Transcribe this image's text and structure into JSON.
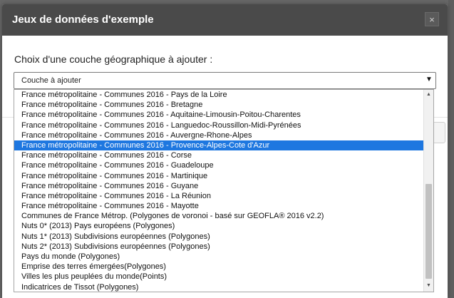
{
  "dialog": {
    "title": "Jeux de données d'exemple",
    "close_glyph": "×"
  },
  "form": {
    "label": "Choix d'une couche géographique à ajouter :",
    "select_value": "Couche à ajouter",
    "select_arrow": "▼"
  },
  "dropdown": {
    "scroll_up_glyph": "▲",
    "scroll_down_glyph": "▼",
    "selected_index": 5,
    "options": [
      "France métropolitaine - Communes 2016 - Pays de la Loire",
      "France métropolitaine - Communes 2016 - Bretagne",
      "France métropolitaine - Communes 2016 - Aquitaine-Limousin-Poitou-Charentes",
      "France métropolitaine - Communes 2016 - Languedoc-Roussillon-Midi-Pyrénées",
      "France métropolitaine - Communes 2016 - Auvergne-Rhone-Alpes",
      "France métropolitaine - Communes 2016 - Provence-Alpes-Cote d'Azur",
      "France métropolitaine - Communes 2016 - Corse",
      "France métropolitaine - Communes 2016 - Guadeloupe",
      "France métropolitaine - Communes 2016 - Martinique",
      "France métropolitaine - Communes 2016 - Guyane",
      "France métropolitaine - Communes 2016 - La Réunion",
      "France métropolitaine - Communes 2016 - Mayotte",
      "Communes de France Métrop. (Polygones de voronoi - basé sur GEOFLA® 2016 v2.2)",
      "Nuts 0* (2013) Pays européens (Polygones)",
      "Nuts 1* (2013) Subdivisions européennes (Polygones)",
      "Nuts 2* (2013) Subdivisions européennes (Polygones)",
      "Pays du monde (Polygones)",
      "Emprise des terres émergées(Polygones)",
      "Villes les plus peuplées du monde(Points)",
      "Indicatrices de Tissot (Polygones)"
    ]
  },
  "colors": {
    "header_bg": "#4a4a4a",
    "selected_bg": "#1e77e0",
    "backdrop": "#676767"
  }
}
